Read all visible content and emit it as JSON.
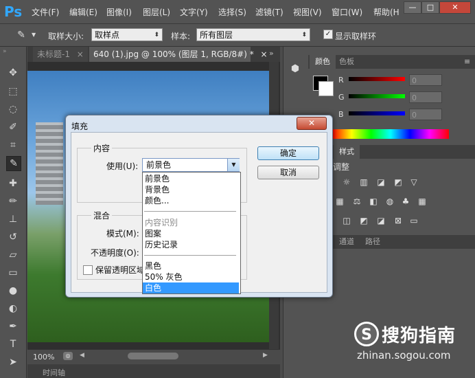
{
  "app": {
    "logo": "Ps"
  },
  "menu": [
    "文件(F)",
    "编辑(E)",
    "图像(I)",
    "图层(L)",
    "文字(Y)",
    "选择(S)",
    "滤镜(T)",
    "视图(V)",
    "窗口(W)",
    "帮助(H"
  ],
  "window_buttons": {
    "minimize": "—",
    "maximize": "□",
    "close": "✕"
  },
  "options": {
    "sample_size_label": "取样大小:",
    "sample_size_value": "取样点",
    "sample_label": "样本:",
    "sample_value": "所有图层",
    "show_ring_label": "显示取样环",
    "show_ring_checked": "✓"
  },
  "tabs": {
    "tab1": "未标题-1",
    "tab2": "640 (1).jpg @ 100% (图层 1, RGB/8#) *",
    "close": "×",
    "more": "»"
  },
  "status": {
    "zoom": "100%",
    "timeline": "时间轴"
  },
  "color_panel": {
    "tabs": [
      "颜色",
      "色板"
    ],
    "r_label": "R",
    "g_label": "G",
    "b_label": "B",
    "r_value": "0",
    "g_value": "0",
    "b_value": "0",
    "foreground": "#000000",
    "background": "#ffffff"
  },
  "adjust_panel": {
    "tab_styles": "样式",
    "heading": "调整"
  },
  "layers_panel": {
    "tabs": [
      "通道",
      "路径"
    ]
  },
  "dialog": {
    "title": "填充",
    "close": "✕",
    "content_group": "内容",
    "use_label": "使用(U):",
    "use_value": "前景色",
    "blend_group": "混合",
    "mode_label": "模式(M):",
    "opacity_label": "不透明度(O):",
    "preserve_label": "保留透明区域",
    "ok": "确定",
    "cancel": "取消"
  },
  "dropdown": {
    "items": [
      {
        "label": "前景色",
        "state": "normal"
      },
      {
        "label": "背景色",
        "state": "normal"
      },
      {
        "label": "颜色...",
        "state": "normal"
      },
      {
        "label": "内容识别",
        "state": "disabled"
      },
      {
        "label": "图案",
        "state": "normal"
      },
      {
        "label": "历史记录",
        "state": "normal"
      },
      {
        "label": "黑色",
        "state": "normal"
      },
      {
        "label": "50% 灰色",
        "state": "normal"
      },
      {
        "label": "白色",
        "state": "selected"
      }
    ]
  },
  "watermark": {
    "logo": "S",
    "title": "搜狗指南",
    "url": "zhinan.sogou.com"
  }
}
